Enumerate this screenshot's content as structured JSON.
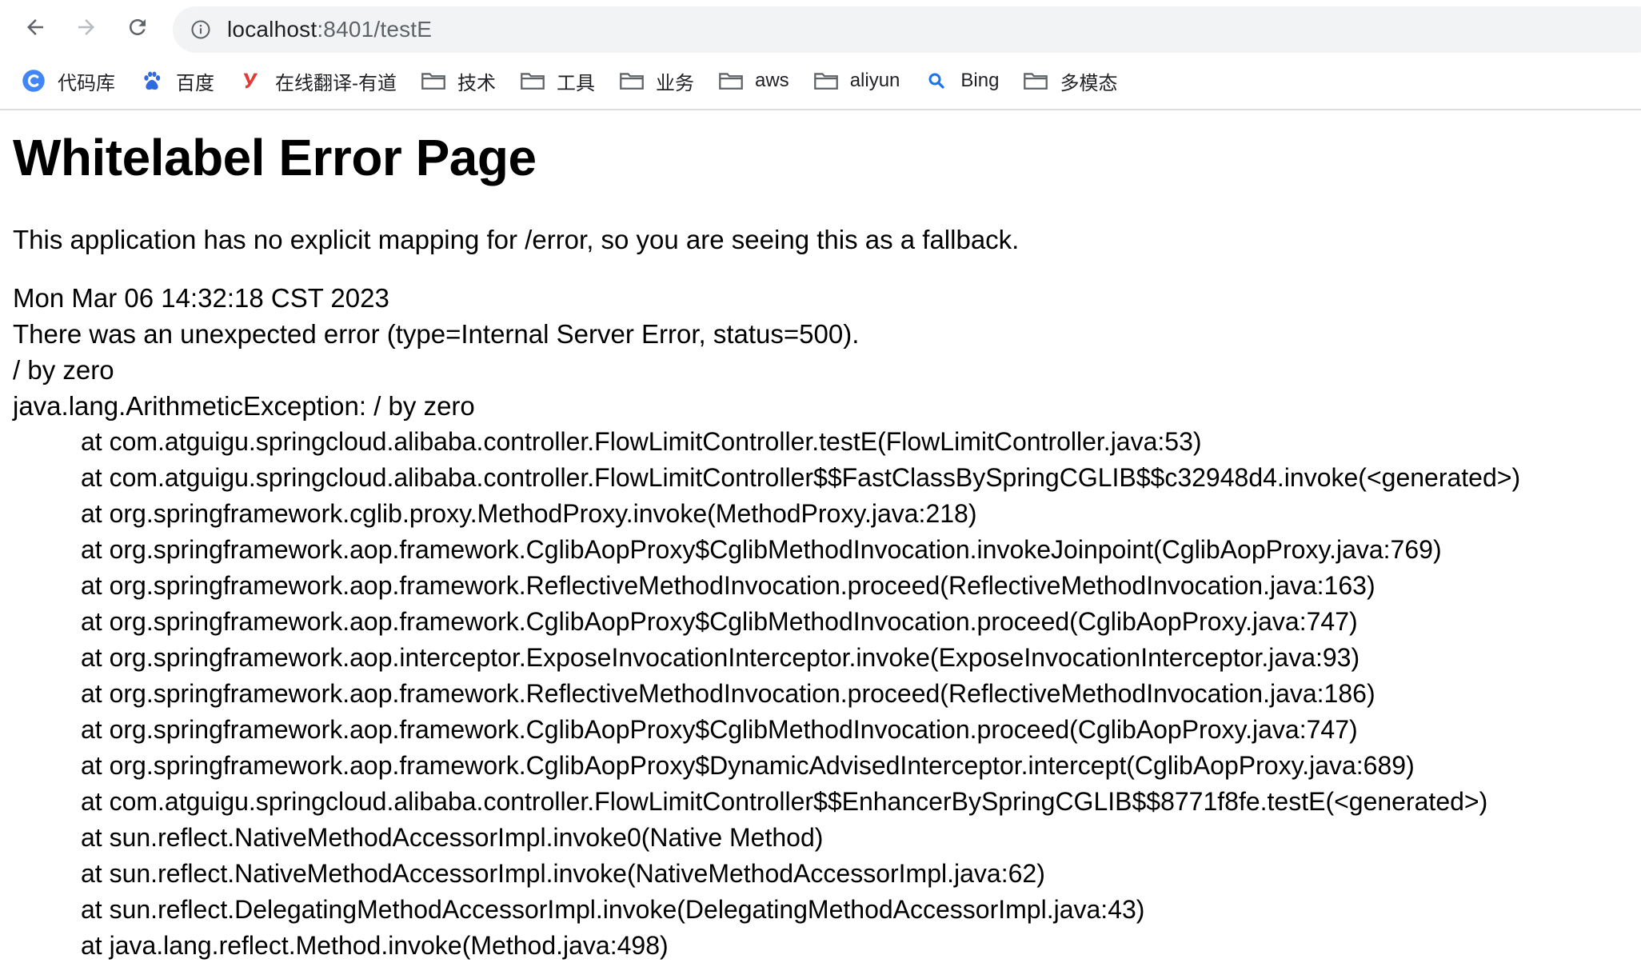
{
  "browser": {
    "url_host": "localhost",
    "url_rest": ":8401/testE",
    "bookmarks": [
      {
        "label": "代码库",
        "icon": "c-logo-icon"
      },
      {
        "label": "百度",
        "icon": "baidu-paw-icon"
      },
      {
        "label": "在线翻译-有道",
        "icon": "youdao-y-icon"
      },
      {
        "label": "技术",
        "icon": "folder-icon"
      },
      {
        "label": "工具",
        "icon": "folder-icon"
      },
      {
        "label": "业务",
        "icon": "folder-icon"
      },
      {
        "label": "aws",
        "icon": "folder-icon"
      },
      {
        "label": "aliyun",
        "icon": "folder-icon"
      },
      {
        "label": "Bing",
        "icon": "search-icon"
      },
      {
        "label": "多模态",
        "icon": "folder-icon"
      }
    ]
  },
  "page": {
    "title": "Whitelabel Error Page",
    "fallback_message": "This application has no explicit mapping for /error, so you are seeing this as a fallback.",
    "timestamp": "Mon Mar 06 14:32:18 CST 2023",
    "error_summary": "There was an unexpected error (type=Internal Server Error, status=500).",
    "error_message": "/ by zero",
    "exception": "java.lang.ArithmeticException: / by zero",
    "stack_trace": [
      "at com.atguigu.springcloud.alibaba.controller.FlowLimitController.testE(FlowLimitController.java:53)",
      "at com.atguigu.springcloud.alibaba.controller.FlowLimitController$$FastClassBySpringCGLIB$$c32948d4.invoke(<generated>)",
      "at org.springframework.cglib.proxy.MethodProxy.invoke(MethodProxy.java:218)",
      "at org.springframework.aop.framework.CglibAopProxy$CglibMethodInvocation.invokeJoinpoint(CglibAopProxy.java:769)",
      "at org.springframework.aop.framework.ReflectiveMethodInvocation.proceed(ReflectiveMethodInvocation.java:163)",
      "at org.springframework.aop.framework.CglibAopProxy$CglibMethodInvocation.proceed(CglibAopProxy.java:747)",
      "at org.springframework.aop.interceptor.ExposeInvocationInterceptor.invoke(ExposeInvocationInterceptor.java:93)",
      "at org.springframework.aop.framework.ReflectiveMethodInvocation.proceed(ReflectiveMethodInvocation.java:186)",
      "at org.springframework.aop.framework.CglibAopProxy$CglibMethodInvocation.proceed(CglibAopProxy.java:747)",
      "at org.springframework.aop.framework.CglibAopProxy$DynamicAdvisedInterceptor.intercept(CglibAopProxy.java:689)",
      "at com.atguigu.springcloud.alibaba.controller.FlowLimitController$$EnhancerBySpringCGLIB$$8771f8fe.testE(<generated>)",
      "at sun.reflect.NativeMethodAccessorImpl.invoke0(Native Method)",
      "at sun.reflect.NativeMethodAccessorImpl.invoke(NativeMethodAccessorImpl.java:62)",
      "at sun.reflect.DelegatingMethodAccessorImpl.invoke(DelegatingMethodAccessorImpl.java:43)",
      "at java.lang.reflect.Method.invoke(Method.java:498)"
    ]
  },
  "colors": {
    "c_logo": "#4285f4",
    "baidu": "#2f6ae0",
    "youdao": "#e53935",
    "folder": "#5f6368",
    "bing_search": "#1a73e8"
  }
}
